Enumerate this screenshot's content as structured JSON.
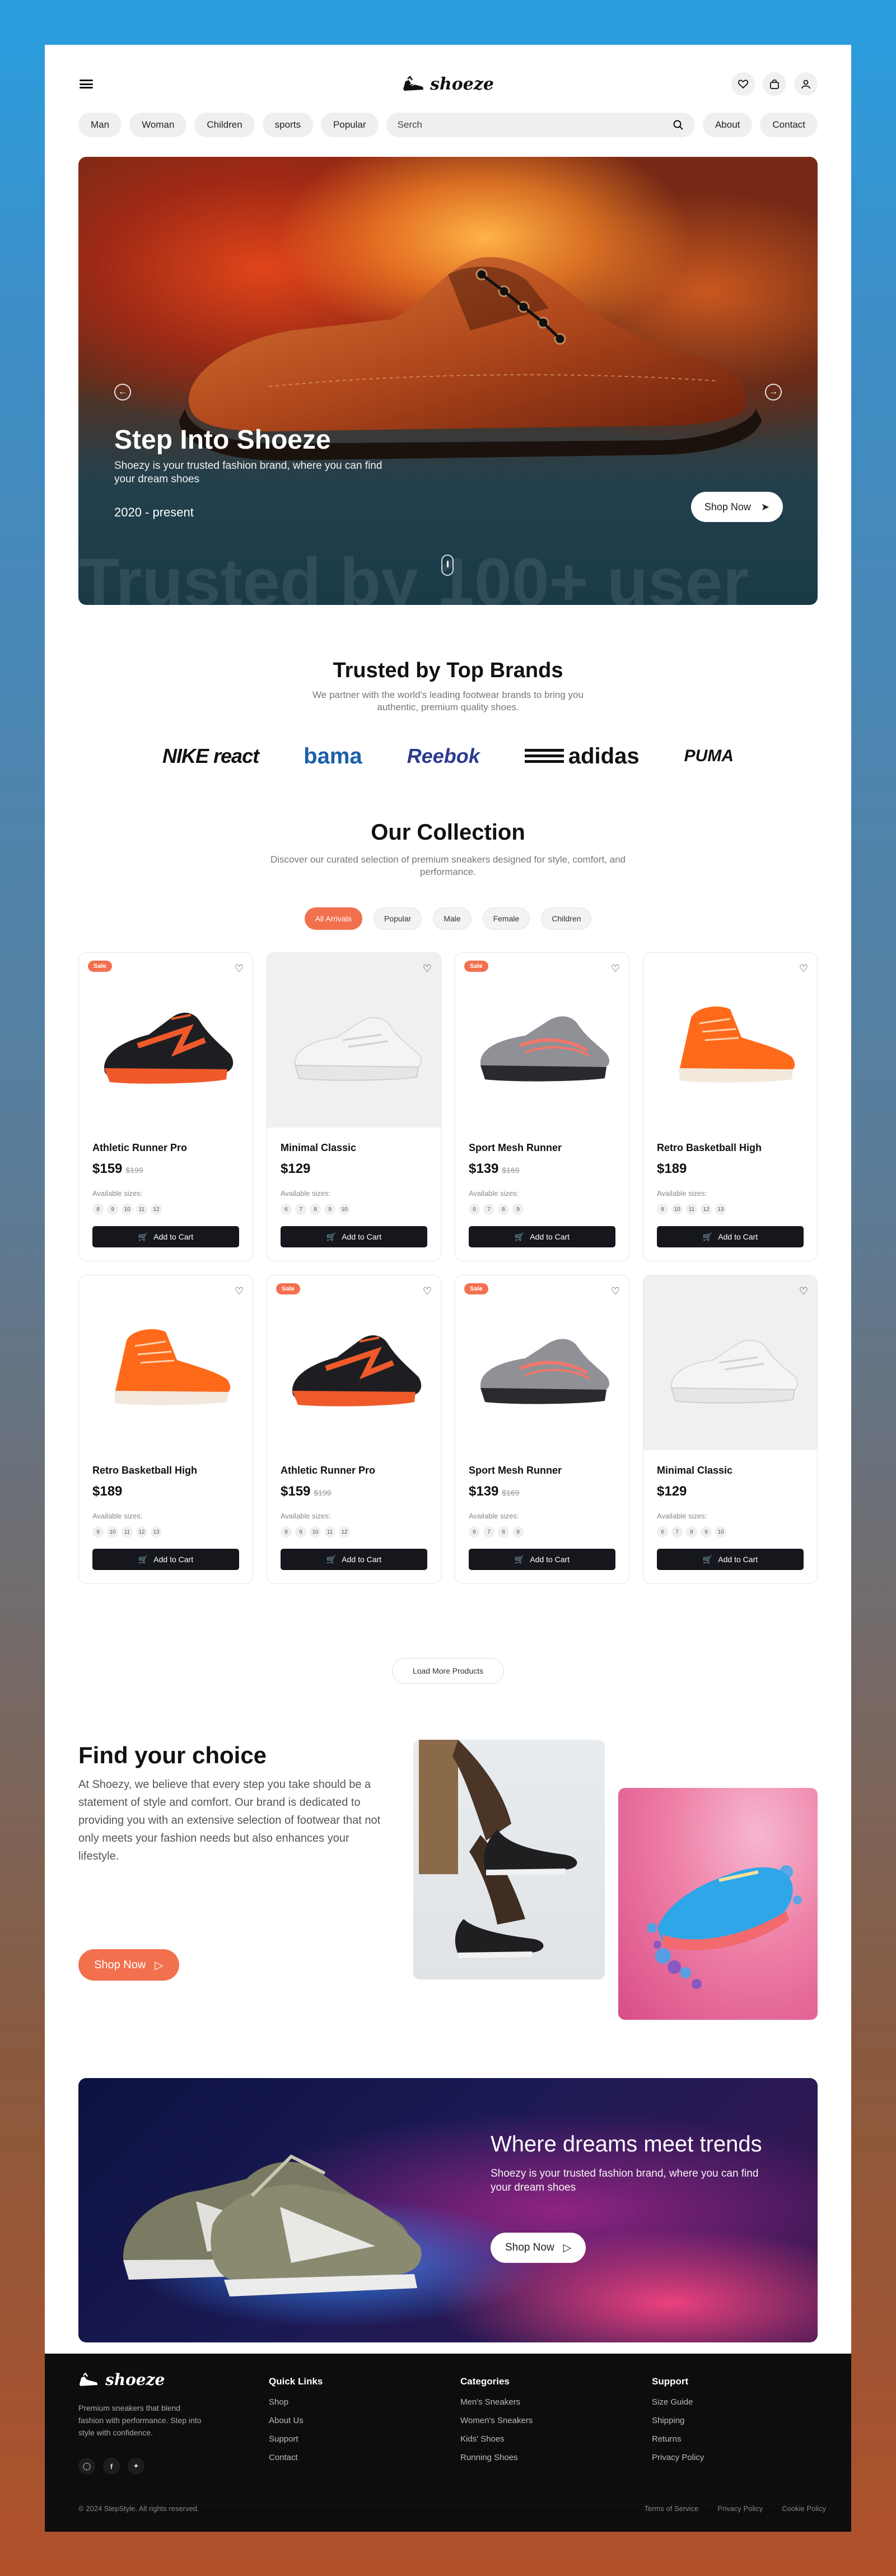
{
  "header": {
    "logo": "shoeze",
    "nav": [
      "Man",
      "Woman",
      "Children",
      "sports",
      "Popular"
    ],
    "search_placeholder": "Serch",
    "right_nav": [
      "About",
      "Contact"
    ],
    "icons": [
      "menu-icon",
      "heart-icon",
      "bag-icon",
      "user-icon",
      "search-icon"
    ]
  },
  "hero": {
    "title": "Step Into Shoeze",
    "subtitle": "Shoezy is your trusted fashion brand, where you can find your dream shoes",
    "years": "2020 - present",
    "cta": "Shop Now",
    "watermark": "Trusted by 100+ user"
  },
  "brands": {
    "title": "Trusted by Top Brands",
    "subtitle": "We partner with the world's leading footwear brands to bring you authentic, premium quality shoes.",
    "logos": [
      "NIKE react",
      "bama",
      "Reebok",
      "adidas",
      "PUMA"
    ]
  },
  "collection": {
    "title": "Our Collection",
    "subtitle": "Discover our curated selection of premium sneakers designed for style, comfort, and performance.",
    "filters": [
      "All Arrivals",
      "Popular",
      "Male",
      "Female",
      "Children"
    ],
    "active_filter": "All Arrivals",
    "sizes_label": "Available sizes:",
    "cart_label": "Add to Cart",
    "sale_label": "Sale",
    "load_more": "Load More Products",
    "products": [
      {
        "name": "Athletic Runner Pro",
        "price": "$159",
        "old_price": "$199",
        "sale": true,
        "sizes": [
          "8",
          "9",
          "10",
          "11",
          "12"
        ],
        "style": "runner"
      },
      {
        "name": "Minimal Classic",
        "price": "$129",
        "old_price": "",
        "sale": false,
        "sizes": [
          "6",
          "7",
          "8",
          "9",
          "10"
        ],
        "style": "white"
      },
      {
        "name": "Sport Mesh Runner",
        "price": "$139",
        "old_price": "$169",
        "sale": true,
        "sizes": [
          "6",
          "7",
          "8",
          "9"
        ],
        "style": "mesh"
      },
      {
        "name": "Retro Basketball High",
        "price": "$189",
        "old_price": "",
        "sale": false,
        "sizes": [
          "9",
          "10",
          "11",
          "12",
          "13"
        ],
        "style": "high"
      },
      {
        "name": "Retro Basketball High",
        "price": "$189",
        "old_price": "",
        "sale": false,
        "sizes": [
          "9",
          "10",
          "11",
          "12",
          "13"
        ],
        "style": "high"
      },
      {
        "name": "Athletic Runner Pro",
        "price": "$159",
        "old_price": "$199",
        "sale": true,
        "sizes": [
          "8",
          "9",
          "10",
          "11",
          "12"
        ],
        "style": "runner"
      },
      {
        "name": "Sport Mesh Runner",
        "price": "$139",
        "old_price": "$169",
        "sale": true,
        "sizes": [
          "6",
          "7",
          "8",
          "9"
        ],
        "style": "mesh"
      },
      {
        "name": "Minimal Classic",
        "price": "$129",
        "old_price": "",
        "sale": false,
        "sizes": [
          "6",
          "7",
          "8",
          "9",
          "10"
        ],
        "style": "white"
      }
    ]
  },
  "choice": {
    "title": "Find your choice",
    "text": "At Shoezy, we believe that every step you take should be a statement of style and comfort. Our brand is dedicated to providing you with an extensive selection of footwear that not only meets your fashion needs but also enhances your lifestyle.",
    "cta": "Shop Now"
  },
  "banner": {
    "title": "Where dreams meet trends",
    "subtitle": "Shoezy is your trusted fashion brand, where you can find your dream shoes",
    "cta": "Shop Now"
  },
  "footer": {
    "brand": "shoeze",
    "description": "Premium sneakers that blend fashion with performance. Step into style with confidence.",
    "columns": [
      {
        "title": "Quick Links",
        "links": [
          "Shop",
          "About Us",
          "Support",
          "Contact"
        ]
      },
      {
        "title": "Categories",
        "links": [
          "Men's Sneakers",
          "Women's Sneakers",
          "Kids' Shoes",
          "Running Shoes"
        ]
      },
      {
        "title": "Support",
        "links": [
          "Size Guide",
          "Shipping",
          "Returns",
          "Privacy Policy"
        ]
      }
    ],
    "copyright": "© 2024 StepStyle. All rights reserved.",
    "legal": [
      "Terms of Service",
      "Privacy Policy",
      "Cookie Policy"
    ]
  },
  "colors": {
    "accent": "#f2704e",
    "dark_button": "#16171c",
    "footer_bg": "#0d0d0d"
  }
}
